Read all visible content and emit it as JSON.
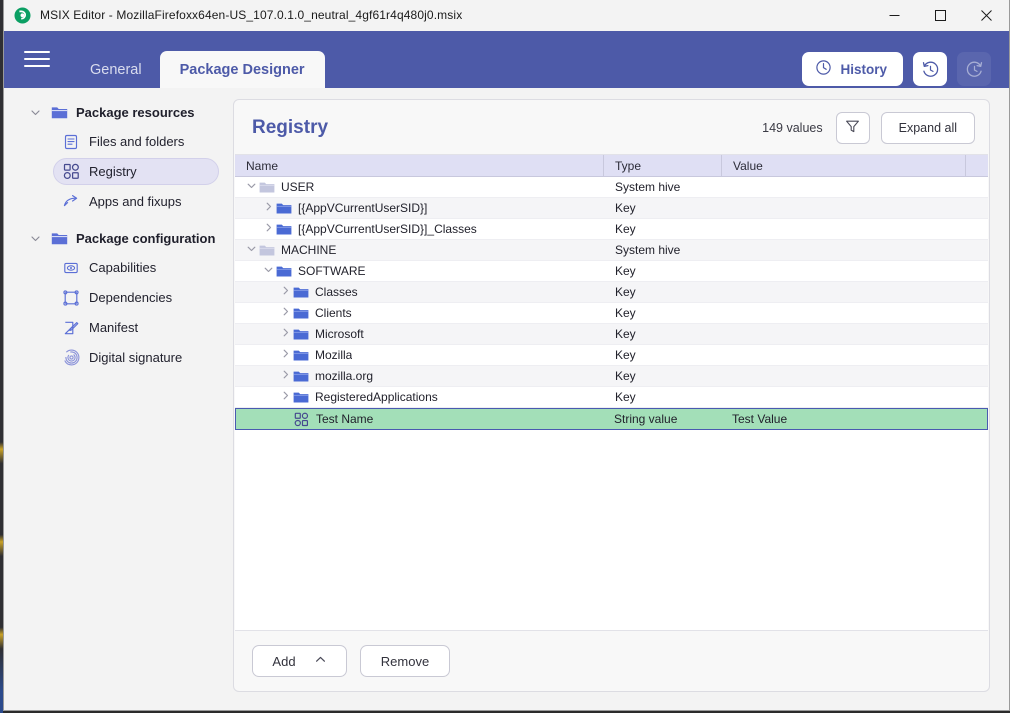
{
  "window": {
    "title": "MSIX Editor - MozillaFirefoxx64en-US_107.0.1.0_neutral_4gf61r4q480j0.msix",
    "app_icon": "msix-editor-icon",
    "minimize_label": "—",
    "maximize_label": "☐",
    "close_label": "✕"
  },
  "ribbon": {
    "menu_icon": "hamburger-menu-icon",
    "tabs": [
      {
        "label": "General",
        "active": false
      },
      {
        "label": "Package Designer",
        "active": true
      }
    ],
    "history_label": "History",
    "history_icon": "clock-icon",
    "undo_icon": "undo-clock-icon",
    "redo_icon": "redo-clock-icon",
    "accent_color": "#4d5aa8"
  },
  "sidebar": {
    "groups": [
      {
        "label": "Package resources",
        "icon": "folder-icon",
        "expanded": true,
        "items": [
          {
            "label": "Files and folders",
            "icon": "document-icon",
            "selected": false
          },
          {
            "label": "Registry",
            "icon": "registry-blocks-icon",
            "selected": true
          },
          {
            "label": "Apps and fixups",
            "icon": "arrow-branch-icon",
            "selected": false
          }
        ]
      },
      {
        "label": "Package configuration",
        "icon": "folder-icon",
        "expanded": true,
        "items": [
          {
            "label": "Capabilities",
            "icon": "capability-icon",
            "selected": false
          },
          {
            "label": "Dependencies",
            "icon": "dependency-box-icon",
            "selected": false
          },
          {
            "label": "Manifest",
            "icon": "manifest-pencil-icon",
            "selected": false
          },
          {
            "label": "Digital signature",
            "icon": "fingerprint-icon",
            "selected": false
          }
        ]
      }
    ]
  },
  "main": {
    "title": "Registry",
    "values_count": "149 values",
    "filter_icon": "filter-funnel-icon",
    "expand_all_label": "Expand all",
    "columns": [
      {
        "key": "name",
        "label": "Name"
      },
      {
        "key": "type",
        "label": "Type"
      },
      {
        "key": "value",
        "label": "Value"
      }
    ],
    "rows": [
      {
        "name": "USER",
        "type": "System hive",
        "value": "",
        "depth": 0,
        "twisty": "expanded",
        "icon": "folder-grey-icon",
        "selected": false
      },
      {
        "name": "[{AppVCurrentUserSID}]",
        "type": "Key",
        "value": "",
        "depth": 1,
        "twisty": "collapsed",
        "icon": "folder-blue-icon",
        "selected": false
      },
      {
        "name": "[{AppVCurrentUserSID}]_Classes",
        "type": "Key",
        "value": "",
        "depth": 1,
        "twisty": "collapsed",
        "icon": "folder-blue-icon",
        "selected": false
      },
      {
        "name": "MACHINE",
        "type": "System hive",
        "value": "",
        "depth": 0,
        "twisty": "expanded",
        "icon": "folder-grey-icon",
        "selected": false
      },
      {
        "name": "SOFTWARE",
        "type": "Key",
        "value": "",
        "depth": 1,
        "twisty": "expanded",
        "icon": "folder-blue-icon",
        "selected": false
      },
      {
        "name": "Classes",
        "type": "Key",
        "value": "",
        "depth": 2,
        "twisty": "collapsed",
        "icon": "folder-blue-icon",
        "selected": false
      },
      {
        "name": "Clients",
        "type": "Key",
        "value": "",
        "depth": 2,
        "twisty": "collapsed",
        "icon": "folder-blue-icon",
        "selected": false
      },
      {
        "name": "Microsoft",
        "type": "Key",
        "value": "",
        "depth": 2,
        "twisty": "collapsed",
        "icon": "folder-blue-icon",
        "selected": false
      },
      {
        "name": "Mozilla",
        "type": "Key",
        "value": "",
        "depth": 2,
        "twisty": "collapsed",
        "icon": "folder-blue-icon",
        "selected": false
      },
      {
        "name": "mozilla.org",
        "type": "Key",
        "value": "",
        "depth": 2,
        "twisty": "collapsed",
        "icon": "folder-blue-icon",
        "selected": false
      },
      {
        "name": "RegisteredApplications",
        "type": "Key",
        "value": "",
        "depth": 2,
        "twisty": "collapsed",
        "icon": "folder-blue-icon",
        "selected": false
      },
      {
        "name": "Test Name",
        "type": "String value",
        "value": "Test Value",
        "depth": 2,
        "twisty": "none",
        "icon": "registry-blocks-icon",
        "selected": true
      }
    ],
    "add_label": "Add",
    "add_chevron_icon": "chevron-up-icon",
    "remove_label": "Remove",
    "selection_color": "#a3dfb8"
  }
}
